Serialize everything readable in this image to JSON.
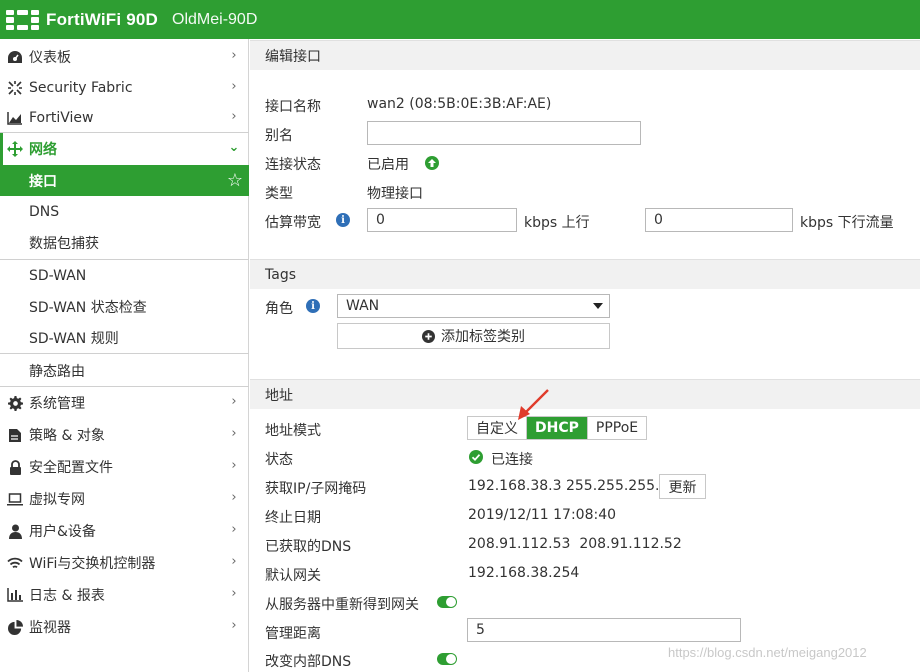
{
  "header": {
    "product": "FortiWiFi 90D",
    "hostname": "OldMei-90D",
    "brand_color": "#2e9e32"
  },
  "sidebar": {
    "items": [
      {
        "label": "仪表板",
        "icon": "dashboard-icon"
      },
      {
        "label": "Security Fabric",
        "icon": "security-fabric-icon"
      },
      {
        "label": "FortiView",
        "icon": "fortiview-chart-icon"
      },
      {
        "label": "网络",
        "icon": "network-move-icon"
      },
      {
        "label": "系统管理",
        "icon": "gear-icon"
      },
      {
        "label": "策略 & 对象",
        "icon": "policy-file-icon"
      },
      {
        "label": "安全配置文件",
        "icon": "lock-icon"
      },
      {
        "label": "虚拟专网",
        "icon": "laptop-icon"
      },
      {
        "label": "用户&设备",
        "icon": "user-icon"
      },
      {
        "label": "WiFi与交换机控制器",
        "icon": "wifi-icon"
      },
      {
        "label": "日志 & 报表",
        "icon": "bar-chart-icon"
      },
      {
        "label": "监视器",
        "icon": "pie-chart-icon"
      }
    ],
    "network_sub": [
      {
        "label": "接口"
      },
      {
        "label": "DNS"
      },
      {
        "label": "数据包捕获"
      },
      {
        "label": "SD-WAN"
      },
      {
        "label": "SD-WAN 状态检查"
      },
      {
        "label": "SD-WAN 规则"
      },
      {
        "label": "静态路由"
      }
    ]
  },
  "main": {
    "edit_section": {
      "title": "编辑接口",
      "name_label": "接口名称",
      "name_value": "wan2 (08:5B:0E:3B:AF:AE)",
      "alias_label": "别名",
      "alias_value": "",
      "status_label": "连接状态",
      "status_value": "已启用",
      "type_label": "类型",
      "type_value": "物理接口",
      "bandwidth_label": "估算带宽",
      "upstream_value": "0",
      "upstream_unit": "kbps 上行",
      "downstream_value": "0",
      "downstream_unit": "kbps 下行流量"
    },
    "tags_section": {
      "title": "Tags",
      "role_label": "角色",
      "role_value": "WAN",
      "add_tag_label": "添加标签类别"
    },
    "address_section": {
      "title": "地址",
      "mode_label": "地址模式",
      "modes": [
        "自定义",
        "DHCP",
        "PPPoE"
      ],
      "mode_selected": "DHCP",
      "state_label": "状态",
      "state_value": "已连接",
      "ip_label": "获取IP/子网掩码",
      "ip_value": "192.168.38.3 255.255.255.0",
      "renew_label": "更新",
      "expiry_label": "终止日期",
      "expiry_value": "2019/12/11 17:08:40",
      "dns_label": "已获取的DNS",
      "dns_value": "208.91.112.53  208.91.112.52",
      "gateway_label": "默认网关",
      "gateway_value": "192.168.38.254",
      "retrieve_gw_label": "从服务器中重新得到网关",
      "distance_label": "管理距离",
      "distance_value": "5",
      "override_dns_label": "改变内部DNS"
    }
  },
  "watermark": "https://blog.csdn.net/meigang2012"
}
